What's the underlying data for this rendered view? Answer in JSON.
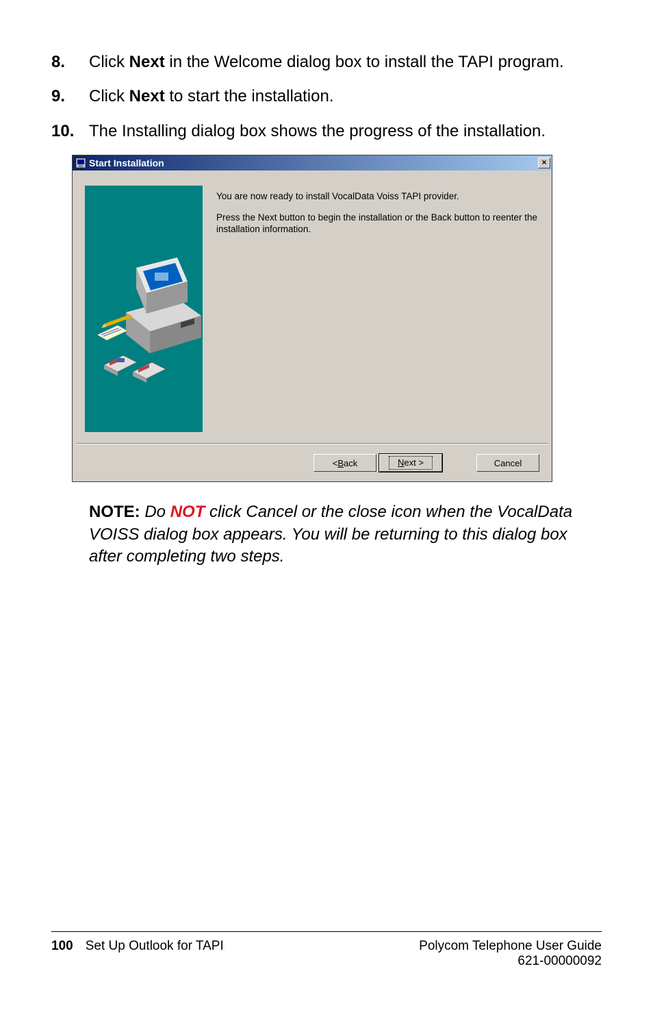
{
  "steps": [
    {
      "num": "8.",
      "prefix": "Click ",
      "bold": "Next",
      "suffix": " in the Welcome dialog box to install the TAPI program."
    },
    {
      "num": "9.",
      "prefix": "Click ",
      "bold": "Next",
      "suffix": " to start the installation."
    },
    {
      "num": "10.",
      "prefix": "The Installing dialog box shows the progress of the installation.",
      "bold": "",
      "suffix": ""
    }
  ],
  "dialog": {
    "title": "Start Installation",
    "line1": "You are now ready to install VocalData Voiss TAPI provider.",
    "line2": "Press the Next button to begin the installation or the Back button to reenter the installation information.",
    "buttons": {
      "back_prefix": "< ",
      "back_u": "B",
      "back_rest": "ack",
      "next_u": "N",
      "next_rest": "ext >",
      "cancel": "Cancel"
    },
    "close_glyph": "×"
  },
  "note": {
    "label": "NOTE: ",
    "do": "Do ",
    "not": "NOT",
    "rest": " click Cancel or the close icon when the VocalData VOISS dialog box appears. You will be returning to this dialog box after completing two steps."
  },
  "footer": {
    "page": "100",
    "section": "Set Up Outlook for TAPI",
    "guide": "Polycom Telephone User Guide",
    "docnum": "621-00000092"
  }
}
